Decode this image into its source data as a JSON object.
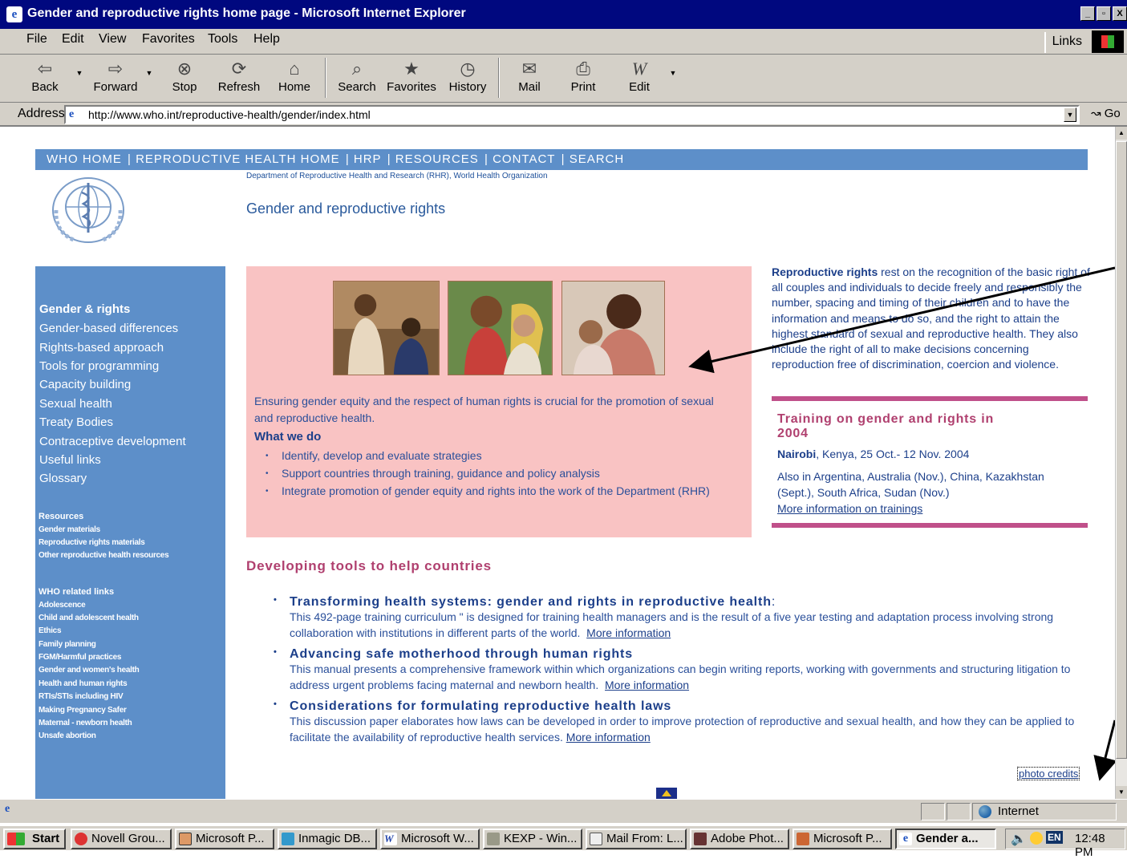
{
  "window": {
    "title": "Gender and reproductive rights home page - Microsoft Internet Explorer",
    "buttons": [
      "_",
      "▫",
      "X"
    ]
  },
  "menubar": {
    "items": [
      "File",
      "Edit",
      "View",
      "Favorites",
      "Tools",
      "Help"
    ],
    "links": "Links"
  },
  "toolbar": {
    "back": "Back",
    "forward": "Forward",
    "stop": "Stop",
    "refresh": "Refresh",
    "home": "Home",
    "search": "Search",
    "favorites": "Favorites",
    "history": "History",
    "mail": "Mail",
    "print": "Print",
    "edit": "Edit"
  },
  "address": {
    "label": "Address",
    "url": "http://www.who.int/reproductive-health/gender/index.html",
    "go": "Go"
  },
  "page": {
    "nav": [
      "WHO HOME",
      "REPRODUCTIVE HEALTH HOME",
      "HRP",
      "RESOURCES",
      "CONTACT",
      "SEARCH"
    ],
    "dept": "Department of Reproductive Health and Research (RHR), World Health Organization",
    "title": "Gender and reproductive rights",
    "sidebar": {
      "heading": "Gender & rights",
      "items": [
        "Gender-based differences",
        "Rights-based approach",
        "Tools for programming",
        "Capacity building",
        "Sexual health",
        "Treaty Bodies",
        "Contraceptive development",
        "Useful links",
        "Glossary"
      ],
      "resources_heading": "Resources",
      "resources": [
        "Gender materials",
        "Reproductive rights materials",
        "Other reproductive health resources"
      ],
      "who_heading": "WHO related links",
      "who_links": [
        "Adolescence",
        "Child and adolescent health",
        "Ethics",
        "Family planning",
        "FGM/Harmful practices",
        "Gender and women's health",
        "Health and human rights",
        "RTIs/STIs including HIV",
        "Making Pregnancy Safer",
        "Maternal - newborn health",
        "Unsafe abortion"
      ]
    },
    "intro": "Ensuring gender equity and the respect of human rights is crucial for the promotion of sexual and reproductive health.",
    "what_we_do": "What we do",
    "bullets": [
      "Identify, develop and evaluate strategies",
      "Support countries through training, guidance and policy analysis",
      "Integrate promotion of gender equity and rights into the work of the Department (RHR)"
    ],
    "rights_bold": "Reproductive rights",
    "rights_text": " rest on the recognition of the basic right of all couples and individuals to decide freely and responsibly the number, spacing and timing of their children and to have the information and means to do so, and the right to attain the highest standard of sexual and reproductive health. They also include the right of all to make decisions concerning reproduction free of discrimination, coercion and violence.",
    "training": {
      "title": "Training on gender and rights in 2004",
      "city": "Nairobi",
      "date": ", Kenya, 25 Oct.- 12 Nov. 2004",
      "also": "Also in Argentina, Australia (Nov.), China, Kazakhstan (Sept.), South Africa, Sudan (Nov.)",
      "more": "More information on trainings"
    },
    "tools_heading": "Developing tools to help countries",
    "tools": [
      {
        "title": "Transforming health systems: gender and rights in reproductive health",
        "suffix": ":",
        "desc": "This 492-page training curriculum \" is designed for training health managers and is the result of a five year testing and adaptation process involving strong collaboration with institutions in different parts of the world.",
        "more": "More information"
      },
      {
        "title": "Advancing safe motherhood through human rights",
        "suffix": "",
        "desc": "This manual  presents a comprehensive framework within which organizations can begin writing reports, working with governments and structuring litigation to address urgent problems facing maternal and newborn health.",
        "more": "More information"
      },
      {
        "title": "Considerations for formulating reproductive health laws",
        "suffix": "",
        "desc": "This discussion paper elaborates how laws can be developed in order to improve protection of reproductive and sexual health, and how they can be applied to facilitate the availability of reproductive health services.",
        "more": "More information"
      }
    ],
    "photo_credits": "photo credits"
  },
  "status": {
    "zone": "Internet"
  },
  "taskbar": {
    "start": "Start",
    "tasks": [
      "Novell Grou...",
      "Microsoft P...",
      "Inmagic DB...",
      "Microsoft W...",
      "KEXP - Win...",
      "Mail From: L...",
      "Adobe Phot...",
      "Microsoft P...",
      "Gender a..."
    ],
    "lang": "EN",
    "time": "12:48 PM"
  },
  "colors": {
    "title_bar": "#00087f",
    "who_blue": "#5d8fc9",
    "pink_panel": "#f9c3c3",
    "magenta": "#b0406f",
    "text_blue": "#1c3f8a"
  }
}
